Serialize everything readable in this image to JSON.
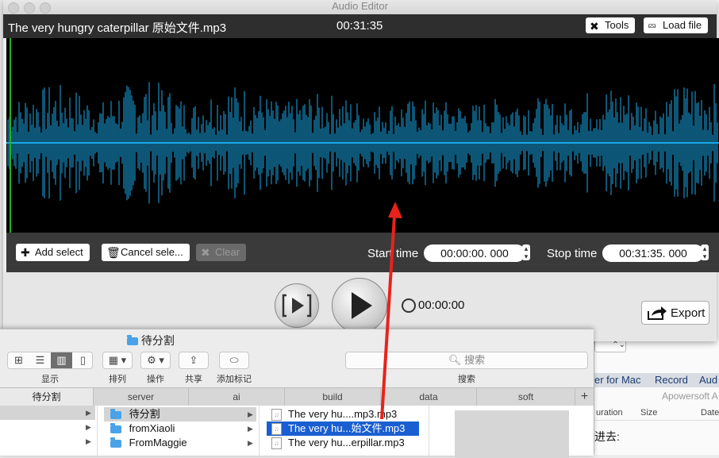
{
  "background_app": {
    "nav_items": [
      "er for Mac",
      "Record",
      "Aud"
    ],
    "brand": "Apowersoft A",
    "columns": [
      "uration",
      "Size",
      "Date"
    ],
    "chinese_text": "进去:"
  },
  "editor": {
    "window_title": "Audio Editor",
    "file_name": "The very hungry caterpillar 原始文件.mp3",
    "duration": "00:31:35",
    "tools_label": "Tools",
    "load_file_label": "Load file",
    "add_select_label": "Add select",
    "cancel_select_label": "Cancel sele...",
    "clear_label": "Clear",
    "start_time_label": "Start time",
    "start_time_value": "00:00:00. 000",
    "stop_time_label": "Stop time",
    "stop_time_value": "00:31:35. 000",
    "current_time": "00:00:00",
    "export_label": "Export",
    "waveform_color": "#1aa7e6",
    "playhead_color": "#1db31d"
  },
  "finder": {
    "title": "待分割",
    "toolbar": {
      "view_label": "显示",
      "sort_label": "排列",
      "action_label": "操作",
      "share_label": "共享",
      "tags_label": "添加标记",
      "search_placeholder": "搜索",
      "search_label": "搜索"
    },
    "path_tabs": [
      "待分割",
      "server",
      "ai",
      "build",
      "data",
      "soft"
    ],
    "add_tab": "+",
    "folders": [
      "待分割",
      "fromXiaoli",
      "FromMaggie"
    ],
    "files": [
      "The very hu....mp3.mp3",
      "The very hu...始文件.mp3",
      "The very hu...erpillar.mp3"
    ]
  },
  "annotation_color": "#e8221c"
}
